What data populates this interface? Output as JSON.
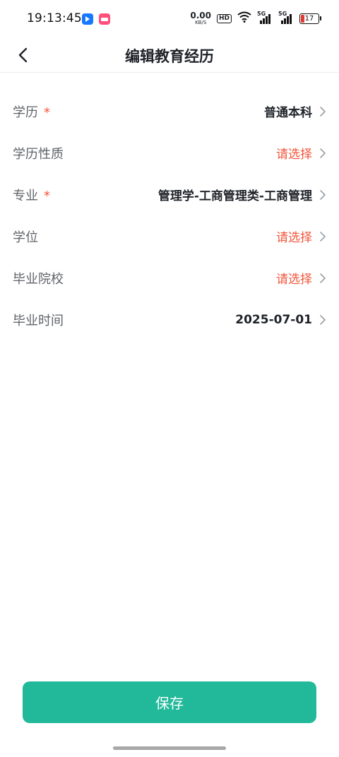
{
  "status_bar": {
    "time": "19:13:45",
    "net_speed_value": "0.00",
    "net_speed_unit": "KB/S",
    "hd_label": "HD",
    "sim1_label": "5G",
    "sim2_label": "5G",
    "battery_level": "17",
    "battery_color": "#e53935"
  },
  "header": {
    "title": "编辑教育经历",
    "back_icon": "chevron-left-icon"
  },
  "form": {
    "rows": [
      {
        "label": "学历",
        "required": "*",
        "value": "普通本科"
      },
      {
        "label": "学历性质",
        "value": "请选择"
      },
      {
        "label": "专业",
        "required": "*",
        "value": "管理学-工商管理类-工商管理"
      },
      {
        "label": "学位",
        "value": "请选择"
      },
      {
        "label": "毕业院校",
        "value": "请选择"
      },
      {
        "label": "毕业时间",
        "value": "2025-07-01"
      }
    ]
  },
  "actions": {
    "save_label": "保存"
  },
  "colors": {
    "accent": "#22b99a",
    "placeholder": "#f2553a",
    "required": "#f2553a"
  }
}
